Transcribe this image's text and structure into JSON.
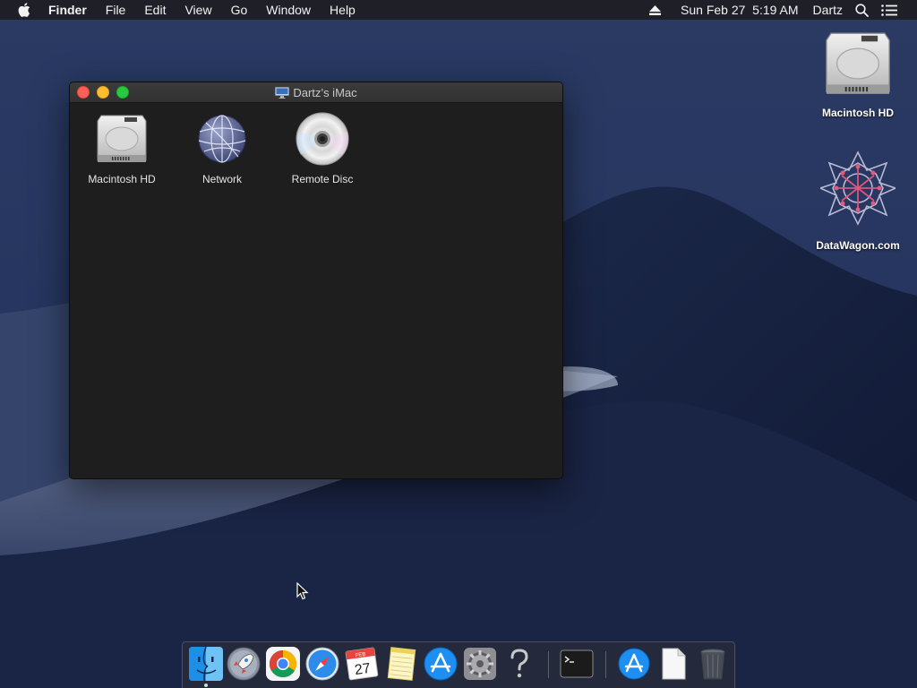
{
  "menubar": {
    "app_name": "Finder",
    "menus": [
      "File",
      "Edit",
      "View",
      "Go",
      "Window",
      "Help"
    ],
    "clock": "Sun Feb 27  5:19 AM",
    "user": "Dartz",
    "icons": [
      "apple-icon",
      "eject-icon",
      "spotlight-icon",
      "notification-center-icon"
    ]
  },
  "window": {
    "title": "Dartz’s iMac",
    "items": [
      {
        "label": "Macintosh HD",
        "icon": "hard-drive-icon"
      },
      {
        "label": "Network",
        "icon": "network-globe-icon"
      },
      {
        "label": "Remote Disc",
        "icon": "remote-disc-icon"
      }
    ]
  },
  "desktop": {
    "items": [
      {
        "label": "Macintosh HD",
        "icon": "hard-drive-icon"
      },
      {
        "label": "DataWagon.com",
        "icon": "datawagon-logo-icon"
      }
    ]
  },
  "dock": {
    "apps": [
      "finder",
      "launchpad",
      "chrome",
      "safari",
      "calendar",
      "notes",
      "app-store",
      "system-preferences",
      "help",
      "terminal",
      "app-store-downloads",
      "document",
      "trash"
    ],
    "calendar": {
      "month": "FEB",
      "day": "27"
    }
  },
  "colors": {
    "menubar_bg": "#1e1e22",
    "window_bg": "#1e1e1e",
    "close": "#fe5f57",
    "minimize": "#febc2e",
    "zoom": "#28c840"
  }
}
